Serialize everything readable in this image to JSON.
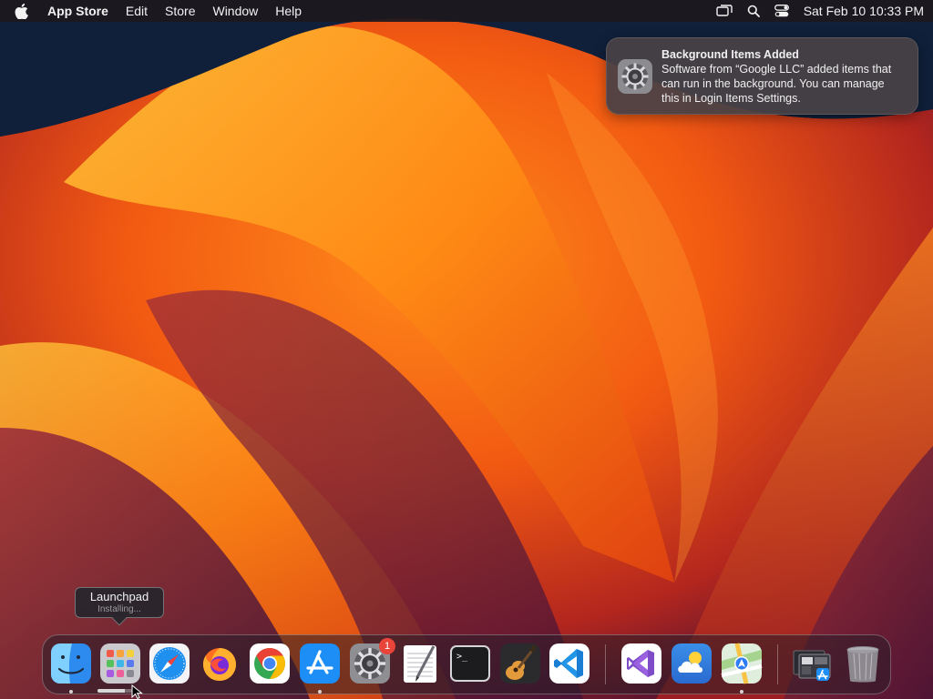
{
  "menubar": {
    "app_name": "App Store",
    "items": [
      "Edit",
      "Store",
      "Window",
      "Help"
    ],
    "clock": "Sat Feb 10  10:33 PM",
    "tray_icons": [
      "screen-mirroring-icon",
      "spotlight-search-icon",
      "control-center-icon"
    ]
  },
  "notification": {
    "title": "Background Items Added",
    "body": "Software from “Google LLC” added items that can run in the background. You can manage this in Login Items Settings.",
    "icon": "system-settings-gear-icon"
  },
  "tooltip": {
    "title": "Launchpad",
    "subtitle": "Installing..."
  },
  "dock": {
    "apps": [
      {
        "name": "Finder",
        "icon": "finder-icon",
        "running": true
      },
      {
        "name": "Launchpad",
        "icon": "launchpad-icon",
        "running": false,
        "install_progress": 0.8
      },
      {
        "name": "Safari",
        "icon": "safari-icon",
        "running": false
      },
      {
        "name": "Firefox",
        "icon": "firefox-icon",
        "running": false
      },
      {
        "name": "Google Chrome",
        "icon": "chrome-icon",
        "running": false
      },
      {
        "name": "App Store",
        "icon": "app-store-icon",
        "running": true
      },
      {
        "name": "System Settings",
        "icon": "system-settings-icon",
        "running": false,
        "badge": "1"
      },
      {
        "name": "TextEdit",
        "icon": "textedit-icon",
        "running": false
      },
      {
        "name": "Terminal",
        "icon": "terminal-icon",
        "running": false
      },
      {
        "name": "GarageBand",
        "icon": "garageband-icon",
        "running": false
      },
      {
        "name": "Visual Studio Code",
        "icon": "vscode-icon",
        "running": false
      },
      {
        "name": "Visual Studio",
        "icon": "visual-studio-icon",
        "running": false
      },
      {
        "name": "Weather",
        "icon": "weather-icon",
        "running": false
      },
      {
        "name": "Maps",
        "icon": "maps-icon",
        "running": true
      },
      {
        "name": "Downloads Stack",
        "icon": "downloads-stack-icon",
        "running": false
      },
      {
        "name": "Trash",
        "icon": "trash-icon",
        "running": false
      }
    ]
  }
}
